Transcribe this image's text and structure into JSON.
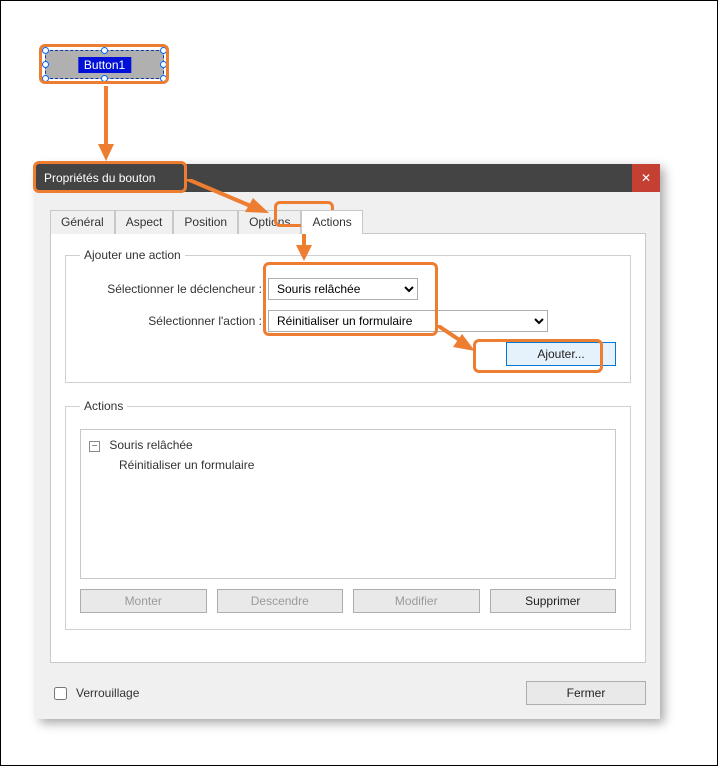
{
  "canvas": {
    "form_button_label": "Button1"
  },
  "dialog": {
    "title": "Propriétés du bouton",
    "tabs": {
      "general": "Général",
      "aspect": "Aspect",
      "position": "Position",
      "options": "Options",
      "actions": "Actions"
    },
    "add_action_group": {
      "legend": "Ajouter une action",
      "trigger_label": "Sélectionner le déclencheur :",
      "trigger_value": "Souris relâchée",
      "action_label": "Sélectionner l'action :",
      "action_value": "Réinitialiser un formulaire",
      "add_button": "Ajouter..."
    },
    "actions_group": {
      "legend": "Actions",
      "tree_root": "Souris relâchée",
      "tree_child": "Réinitialiser un formulaire",
      "up": "Monter",
      "down": "Descendre",
      "edit": "Modifier",
      "delete": "Supprimer"
    },
    "lock_label": "Verrouillage",
    "close_label": "Fermer"
  }
}
